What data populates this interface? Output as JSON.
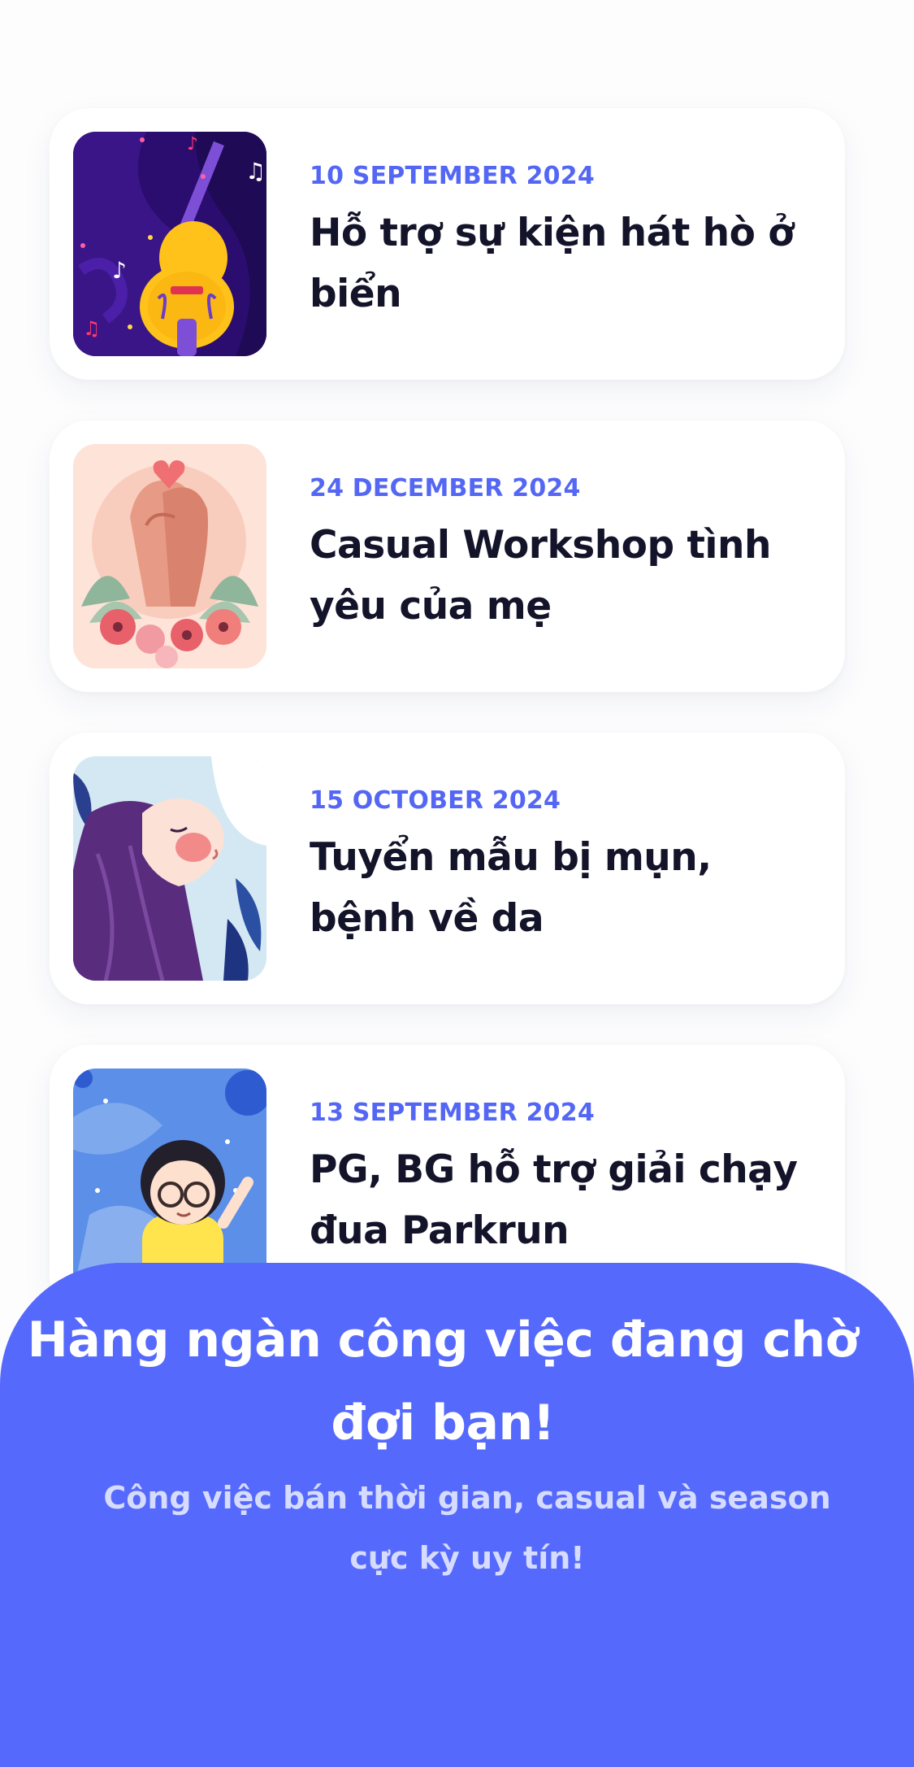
{
  "events": [
    {
      "date": "10 SEPTEMBER 2024",
      "title": "Hỗ trợ sự kiện hát hò ở biển",
      "image_icon": "guitar-music-illustration"
    },
    {
      "date": "24 DECEMBER 2024",
      "title": "Casual Workshop tình yêu của mẹ",
      "image_icon": "hands-flowers-illustration"
    },
    {
      "date": "15  OCTOBER 2024",
      "title": "Tuyển mẫu bị mụn, bệnh về da",
      "image_icon": "woman-face-illustration"
    },
    {
      "date": "13 SEPTEMBER 2024",
      "title": "PG, BG hỗ trợ giải chạy đua Parkrun",
      "image_icon": "girl-balloon-illustration"
    }
  ],
  "promo": {
    "title": "Hàng ngàn công việc đang chờ đợi bạn!",
    "subtitle": "Công việc bán thời gian, casual và season cực kỳ uy tín!"
  },
  "colors": {
    "accent": "#5669fd",
    "date": "#5467f4",
    "title": "#13132a",
    "card": "#ffffff"
  }
}
